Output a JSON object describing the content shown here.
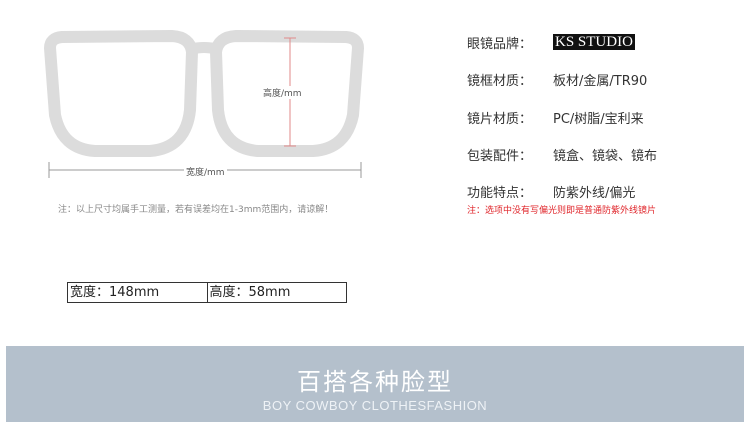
{
  "diagram": {
    "height_label": "高度/mm",
    "width_label": "宽度/mm",
    "note": "注：以上尺寸均属手工测量，若有误差均在1-3mm范围内，请谅解！"
  },
  "specs": {
    "brand": {
      "label": "眼镜品牌：",
      "value": "KS STUDIO"
    },
    "frame": {
      "label": "镜框材质：",
      "value": "板材/金属/TR90"
    },
    "lens": {
      "label": "镜片材质：",
      "value": "PC/树脂/宝利来"
    },
    "package": {
      "label": "包装配件：",
      "value": "镜盒、镜袋、镜布"
    },
    "feature": {
      "label": "功能特点：",
      "value": "防紫外线/偏光"
    },
    "red_note": "注：选项中没有写偏光则即是普通防紫外线镜片"
  },
  "size": {
    "width": "宽度：148mm",
    "height": "高度：58mm"
  },
  "banner": {
    "title": "百搭各种脸型",
    "subtitle": "BOY COWBOY CLOTHESFASHION"
  },
  "colors": {
    "banner_bg": "#b4c0cc",
    "note_red": "#e0262b",
    "frame_gray": "#d9d9d9"
  }
}
